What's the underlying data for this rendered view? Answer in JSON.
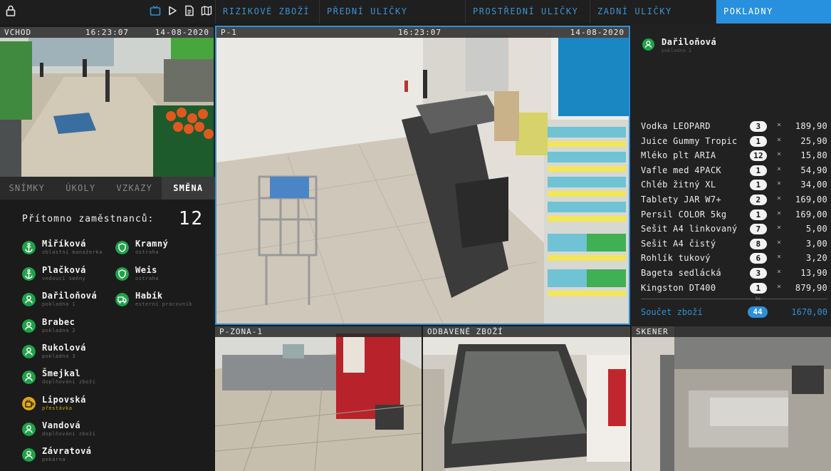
{
  "topbar": {
    "tabs": [
      {
        "label": "RIZIKOVÉ ZBOŽÍ"
      },
      {
        "label": "PŘEDNÍ ULIČKY"
      },
      {
        "label": "PROSTŘEDNÍ ULIČKY"
      },
      {
        "label": "ZADNÍ ULIČKY"
      },
      {
        "label": "POKLADNY"
      }
    ],
    "active_tab": "POKLADNY",
    "icons": [
      "lock-icon",
      "tv-icon",
      "play-icon",
      "document-icon",
      "map-icon"
    ],
    "accent_color": "#2791df"
  },
  "cameras": {
    "entrance": {
      "name": "VCHOD",
      "time": "16:23:07",
      "date": "14-08-2020"
    },
    "main": {
      "name": "P-1",
      "time": "16:23:07",
      "date": "14-08-2020"
    },
    "zone": {
      "name": "P-ZONA-1"
    },
    "weighed": {
      "name": "ODBAVENÉ ZBOŽÍ"
    },
    "scanner": {
      "name": "SKENER"
    }
  },
  "leftpanel": {
    "tabs": [
      {
        "label": "SNÍMKY"
      },
      {
        "label": "ÚKOLY"
      },
      {
        "label": "VZKAZY"
      },
      {
        "label": "SMĚNA"
      }
    ],
    "active_tab": "SMĚNA",
    "present_label": "Přítomno zaměstnanců:",
    "present_count": "12",
    "employees": [
      {
        "name": "Miříková",
        "role": "oblastní manažerka",
        "icon": "anchor-icon",
        "color": "#21a14a"
      },
      {
        "name": "Kramný",
        "role": "ostraha",
        "icon": "shield-icon",
        "color": "#21a14a"
      },
      {
        "name": "Plačková",
        "role": "vedoucí směny",
        "icon": "anchor-icon",
        "color": "#21a14a"
      },
      {
        "name": "Weis",
        "role": "ostraha",
        "icon": "shield-icon",
        "color": "#21a14a"
      },
      {
        "name": "Dařiloňová",
        "role": "pokladna 1",
        "icon": "person-icon",
        "color": "#21a14a"
      },
      {
        "name": "Habík",
        "role": "externí pracovník",
        "icon": "truck-icon",
        "color": "#21a14a"
      },
      {
        "name": "Brabec",
        "role": "pokladna 2",
        "icon": "person-icon",
        "color": "#21a14a"
      },
      {
        "name": "Rukolová",
        "role": "pokladna 3",
        "icon": "person-icon",
        "color": "#21a14a"
      },
      {
        "name": "Šmejkal",
        "role": "doplňování zboží",
        "icon": "person-icon",
        "color": "#21a14a"
      },
      {
        "name": "Lipovská",
        "role": "přestávka",
        "icon": "coffee-icon",
        "color": "#e0a81a"
      },
      {
        "name": "Vandová",
        "role": "doplňování zboží",
        "icon": "person-icon",
        "color": "#21a14a"
      },
      {
        "name": "Závratová",
        "role": "pekárna",
        "icon": "person-icon",
        "color": "#21a14a"
      }
    ]
  },
  "receipt": {
    "cashier_name": "Dařiloňová",
    "cashier_role": "pokladna 1",
    "items": [
      {
        "name": "Vodka LEOPARD",
        "qty": "3",
        "price": "189,90"
      },
      {
        "name": "Juice Gummy Tropic",
        "qty": "1",
        "price": "25,90"
      },
      {
        "name": "Mléko plt ARIA",
        "qty": "12",
        "price": "15,80"
      },
      {
        "name": "Vafle med 4PACK",
        "qty": "1",
        "price": "54,90"
      },
      {
        "name": "Chléb žitný XL",
        "qty": "1",
        "price": "34,00"
      },
      {
        "name": "Tablety JAR W7+",
        "qty": "2",
        "price": "169,00"
      },
      {
        "name": "Persil COLOR 5kg",
        "qty": "1",
        "price": "169,00"
      },
      {
        "name": "Sešit A4 linkovaný",
        "qty": "7",
        "price": "5,00"
      },
      {
        "name": "Sešit A4 čistý",
        "qty": "8",
        "price": "3,00"
      },
      {
        "name": "Rohlík tukový",
        "qty": "6",
        "price": "3,20"
      },
      {
        "name": "Bageta sedlácká",
        "qty": "3",
        "price": "13,90"
      },
      {
        "name": "Kingston DT400",
        "qty": "1",
        "price": "879,90"
      }
    ],
    "multiply_sign": "×",
    "units_label": "ks",
    "total_label": "Součet zboží",
    "total_qty": "44",
    "total_price": "1670,00"
  }
}
